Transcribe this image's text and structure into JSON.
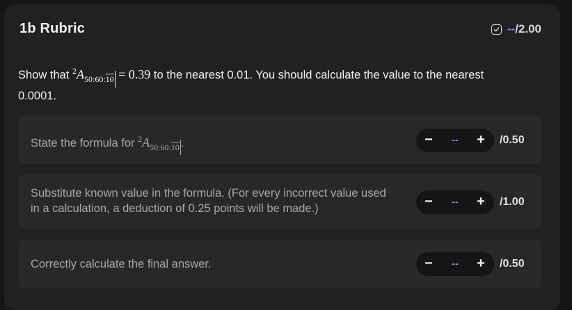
{
  "header": {
    "title": "1b Rubric",
    "score_dash": "--",
    "score_total": "/2.00"
  },
  "question": {
    "prefix": "Show that",
    "math_sup": "2",
    "math_A": "A",
    "math_sub_a": "50:60:",
    "math_sub_b": "10",
    "math_eq": "= 0.39",
    "suffix": "to the nearest 0.01. You should calculate the value to the nearest 0.0001."
  },
  "criteria": [
    {
      "text": "State the formula for",
      "math_sup": "2",
      "math_A": "A",
      "math_sub_a": "50:60:",
      "math_sub_b": "10",
      "after": ".",
      "value": "--",
      "max": "/0.50"
    },
    {
      "text": "Substitute known value in the formula. (For every incorrect value used in a calculation, a deduction of 0.25 points will be made.)",
      "value": "--",
      "max": "/1.00"
    },
    {
      "text": "Correctly calculate the final answer.",
      "value": "--",
      "max": "/0.50"
    }
  ],
  "stepper_labels": {
    "minus": "−",
    "plus": "+"
  },
  "icons": {
    "score_icon": "checkbox-icon"
  },
  "colors": {
    "accent": "#8d86e8",
    "background": "#212121",
    "card": "#282828"
  }
}
